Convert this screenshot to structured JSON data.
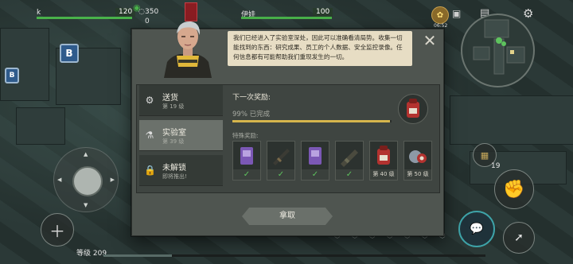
{
  "top_hud": {
    "player_name": "k",
    "player_hp": "120",
    "stat_value": "350",
    "stat_zero": "0",
    "companion_name": "伊娃",
    "companion_hp": "100",
    "clock": "06:52"
  },
  "dialog": {
    "story_text": "我们已经进入了实验室深处，因此可以准确看清局势。收集一切能找到的东西：研究成果、员工的个人数据、安全监控录像。任何信息都有可能帮助我们重现发生的一切。",
    "tabs": [
      {
        "name": "送货",
        "level": "第 19 级",
        "icon": "delivery-icon"
      },
      {
        "name": "实验室",
        "level": "第 39 级",
        "icon": "lab-flask-icon"
      },
      {
        "name": "未解锁",
        "level": "即将推出!",
        "icon": "lock-icon"
      }
    ],
    "next_reward_label": "下一次奖励:",
    "progress_text": "99% 已完成",
    "progress_value": 0.99,
    "special_label": "特殊奖励:",
    "special_rewards": [
      {
        "item": "purple-card-item",
        "status": "✓"
      },
      {
        "item": "rifle-item",
        "status": "✓"
      },
      {
        "item": "purple-card-item",
        "status": "✓"
      },
      {
        "item": "heavy-rifle-item",
        "status": "✓"
      },
      {
        "item": "red-backpack-item",
        "status": "第 40 级"
      },
      {
        "item": "helmet-gear-item",
        "status": "第 50 级"
      }
    ],
    "claim_label": "拿取"
  },
  "bottom_hud": {
    "level_text": "等级 209",
    "ammo_count": "19"
  },
  "colors": {
    "progress_gold": "#d6b54c",
    "health_green": "#49b24a",
    "check_green": "#5ec35e"
  }
}
